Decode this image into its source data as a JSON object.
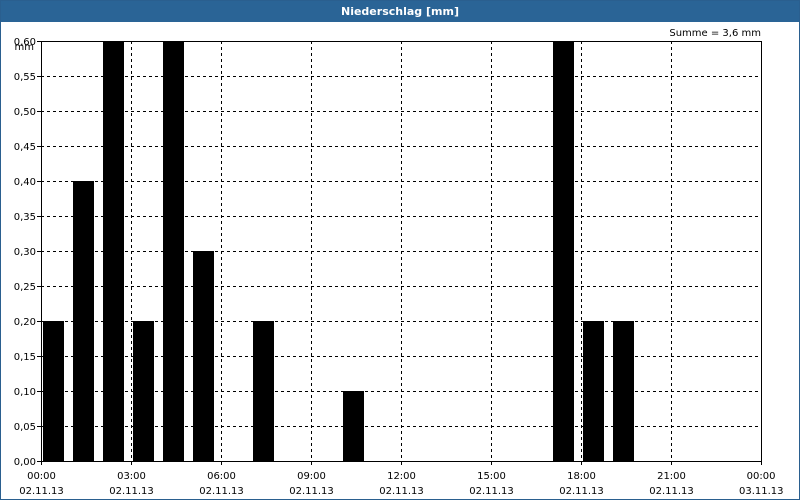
{
  "window": {
    "title": "Niederschlag [mm]"
  },
  "summary": "Summe = 3,6 mm",
  "colors": {
    "title_bar": "#2a6496",
    "bars": "#000000",
    "grid": "#000000"
  },
  "chart_data": {
    "type": "bar",
    "title": "Niederschlag [mm]",
    "ylabel": "mm",
    "xlabel": "",
    "ylim": [
      0,
      0.6
    ],
    "y_ticks": [
      "0,00",
      "0,05",
      "0,10",
      "0,15",
      "0,20",
      "0,25",
      "0,30",
      "0,35",
      "0,40",
      "0,45",
      "0,50",
      "0,55",
      "0,60"
    ],
    "x_ticks": [
      {
        "time": "00:00",
        "date": "02.11.13"
      },
      {
        "time": "03:00",
        "date": "02.11.13"
      },
      {
        "time": "06:00",
        "date": "02.11.13"
      },
      {
        "time": "09:00",
        "date": "02.11.13"
      },
      {
        "time": "12:00",
        "date": "02.11.13"
      },
      {
        "time": "15:00",
        "date": "02.11.13"
      },
      {
        "time": "18:00",
        "date": "02.11.13"
      },
      {
        "time": "21:00",
        "date": "02.11.13"
      },
      {
        "time": "00:00",
        "date": "03.11.13"
      }
    ],
    "x_start": "02.11.13 00:00",
    "x_end": "03.11.13 00:00",
    "bar_interval_hours": 1,
    "bars": [
      {
        "time": "02.11.13 00:00",
        "value": 0.2
      },
      {
        "time": "02.11.13 01:00",
        "value": 0.4
      },
      {
        "time": "02.11.13 02:00",
        "value": 0.6
      },
      {
        "time": "02.11.13 03:00",
        "value": 0.2
      },
      {
        "time": "02.11.13 04:00",
        "value": 0.6
      },
      {
        "time": "02.11.13 05:00",
        "value": 0.3
      },
      {
        "time": "02.11.13 07:00",
        "value": 0.2
      },
      {
        "time": "02.11.13 10:00",
        "value": 0.1
      },
      {
        "time": "02.11.13 17:00",
        "value": 0.6
      },
      {
        "time": "02.11.13 18:00",
        "value": 0.2
      },
      {
        "time": "02.11.13 19:00",
        "value": 0.2
      }
    ],
    "grid": true,
    "legend": "none"
  }
}
